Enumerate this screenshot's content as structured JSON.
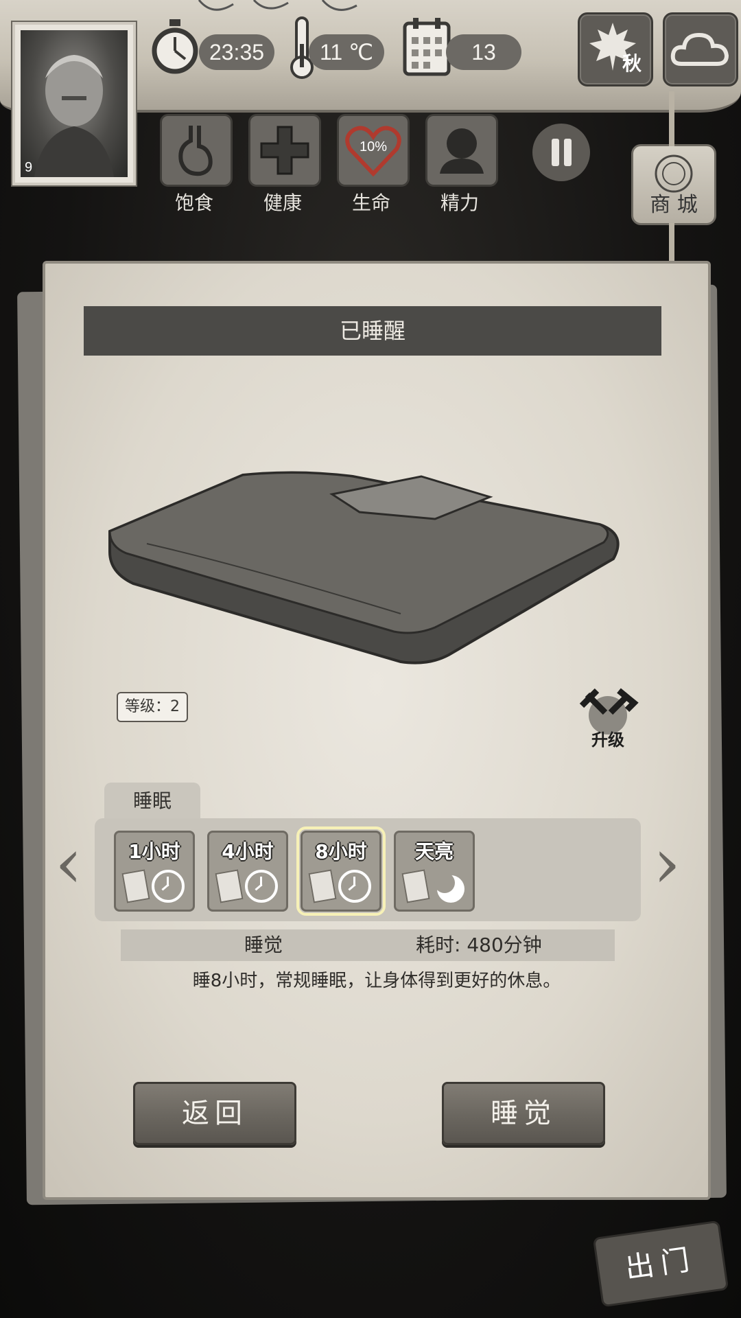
{
  "hud": {
    "level": "9",
    "time": "23:35",
    "temperature": "11 ℃",
    "day": "13",
    "season": "秋"
  },
  "status": [
    {
      "label": "饱食",
      "icon": "stomach-icon"
    },
    {
      "label": "健康",
      "icon": "cross-icon"
    },
    {
      "label": "生命",
      "icon": "heart-icon",
      "value": "10%"
    },
    {
      "label": "精力",
      "icon": "person-icon"
    }
  ],
  "shop_label": "商 城",
  "panel": {
    "title": "已睡醒",
    "level_label": "等级：2",
    "upgrade_label": "升级",
    "tab_label": "睡眠",
    "options": [
      {
        "label": "1小时",
        "icon": "clock-icon",
        "selected": false
      },
      {
        "label": "4小时",
        "icon": "clock-icon",
        "selected": false
      },
      {
        "label": "8小时",
        "icon": "clock-icon",
        "selected": true
      },
      {
        "label": "天亮",
        "icon": "moon-icon",
        "selected": false
      }
    ],
    "action_name": "睡觉",
    "duration": "耗时: 480分钟",
    "description": "睡8小时，常规睡眠，让身体得到更好的休息。",
    "back_label": "返回",
    "sleep_label": "睡觉"
  },
  "exit_label": "出门"
}
